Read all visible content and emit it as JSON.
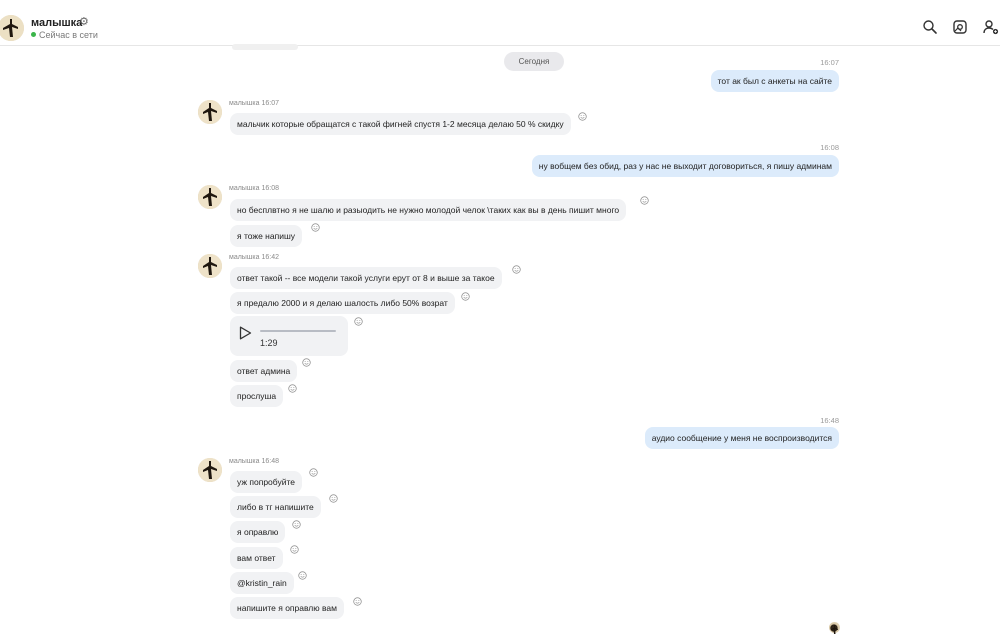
{
  "header": {
    "name": "малышка",
    "status": "Сейчас в сети",
    "icons": [
      "search-icon",
      "gallery-icon",
      "add-user-icon"
    ]
  },
  "date_separator": "Сегодня",
  "messages": {
    "m1": {
      "time": "16:07",
      "text": "тот ак был с анкеты на сайте"
    },
    "g1": {
      "sender": "малышка 16:07",
      "texts": [
        "мальчик которые обращатся с такой фигней спустя 1-2 месяца делаю 50 % скидку"
      ]
    },
    "m2": {
      "time": "16:08",
      "text": "ну вобщем без обид, раз у нас не выходит договориться, я пишу админам"
    },
    "g2": {
      "sender": "малышка 16:08",
      "texts": [
        "но бесплвтно я не шалю и разыодить не нужно молодой челок \\таких как вы в день пишит много",
        "я тоже напишу"
      ]
    },
    "g3": {
      "sender": "малышка 16:42",
      "texts": [
        "ответ такой -- все модели такой услуги ерут от 8 и выше за такое",
        "я предалю 2000 и я делаю шалость либо 50% возрат",
        "ответ админа",
        "прослуша"
      ],
      "audio_duration": "1:29"
    },
    "m3": {
      "time": "16:48",
      "text": "аудио сообщение у меня не воспроизводится"
    },
    "g4": {
      "sender": "малышка 16:48",
      "texts": [
        "уж попробуйте",
        "либо в тг напишите",
        "я оправлю",
        "вам ответ",
        "@kristin_rain",
        "напишите я оправлю вам"
      ]
    }
  },
  "colors": {
    "incoming_bubble": "#f1f2f4",
    "outgoing_bubble": "#dcebfb",
    "online_dot": "#3bb54a"
  }
}
